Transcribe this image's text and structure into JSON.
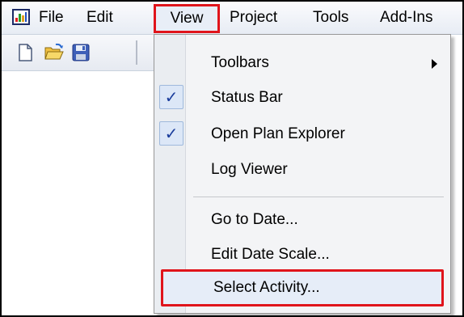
{
  "menubar": {
    "items": [
      "File",
      "Edit",
      "View",
      "Project",
      "Tools",
      "Add-Ins"
    ],
    "active": "View"
  },
  "toolbar": {
    "buttons": [
      "new-document-icon",
      "open-folder-icon",
      "save-icon"
    ]
  },
  "view_menu": {
    "items": [
      {
        "label": "Toolbars",
        "submenu": true
      },
      {
        "label": "Status Bar",
        "checked": true
      },
      {
        "label": "Open Plan Explorer",
        "checked": true
      },
      {
        "label": "Log Viewer"
      },
      {
        "label": "Go to Date..."
      },
      {
        "label": "Edit Date Scale..."
      },
      {
        "label": "Select Activity...",
        "highlighted": true
      }
    ]
  },
  "colors": {
    "highlight_border": "#e0141b",
    "check_mark": "#1a3d9c"
  }
}
